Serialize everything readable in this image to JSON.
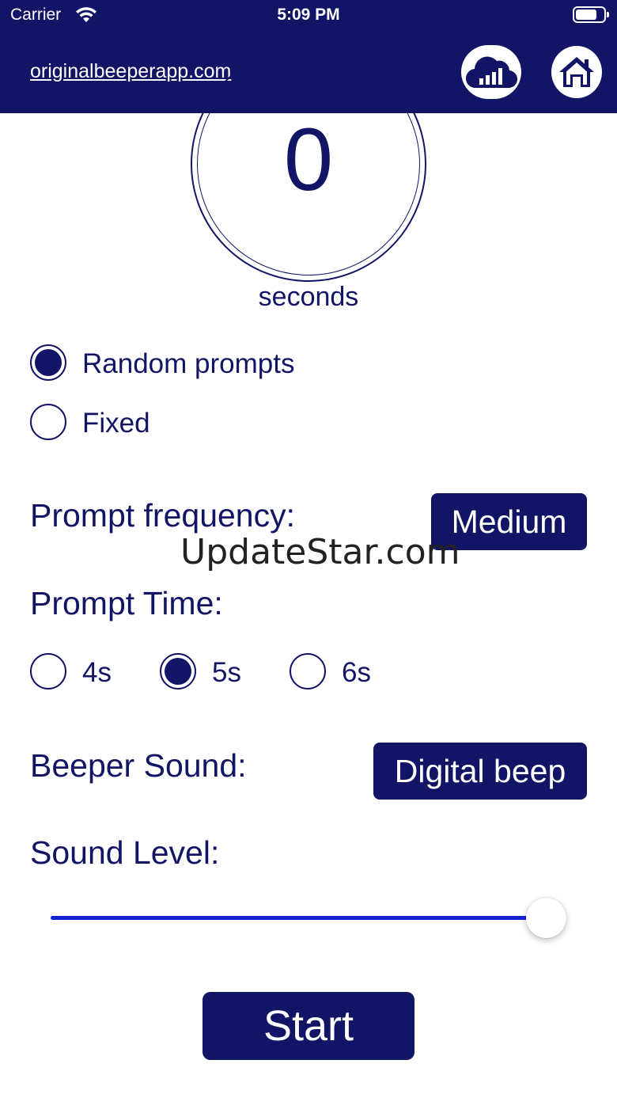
{
  "status_bar": {
    "carrier": "Carrier",
    "time": "5:09 PM"
  },
  "header": {
    "site_link": "originalbeeperapp.com",
    "cloud_button_icon": "cloud-bar-chart-icon",
    "home_button_icon": "home-icon"
  },
  "timer": {
    "value": "0",
    "unit_label": "seconds"
  },
  "prompt_mode": {
    "options": [
      {
        "label": "Random prompts",
        "selected": true
      },
      {
        "label": "Fixed",
        "selected": false
      }
    ]
  },
  "prompt_frequency": {
    "label": "Prompt frequency:",
    "value": "Medium"
  },
  "watermark": "UpdateStar.com",
  "prompt_time": {
    "label": "Prompt Time:",
    "options": [
      {
        "label": "4s",
        "selected": false
      },
      {
        "label": "5s",
        "selected": true
      },
      {
        "label": "6s",
        "selected": false
      }
    ]
  },
  "beeper_sound": {
    "label": "Beeper Sound:",
    "value": "Digital beep"
  },
  "sound_level": {
    "label": "Sound Level:",
    "value_percent": 100
  },
  "start_button": {
    "label": "Start"
  },
  "colors": {
    "primary": "#121566",
    "slider_track": "#1220d6",
    "background": "#ffffff"
  }
}
